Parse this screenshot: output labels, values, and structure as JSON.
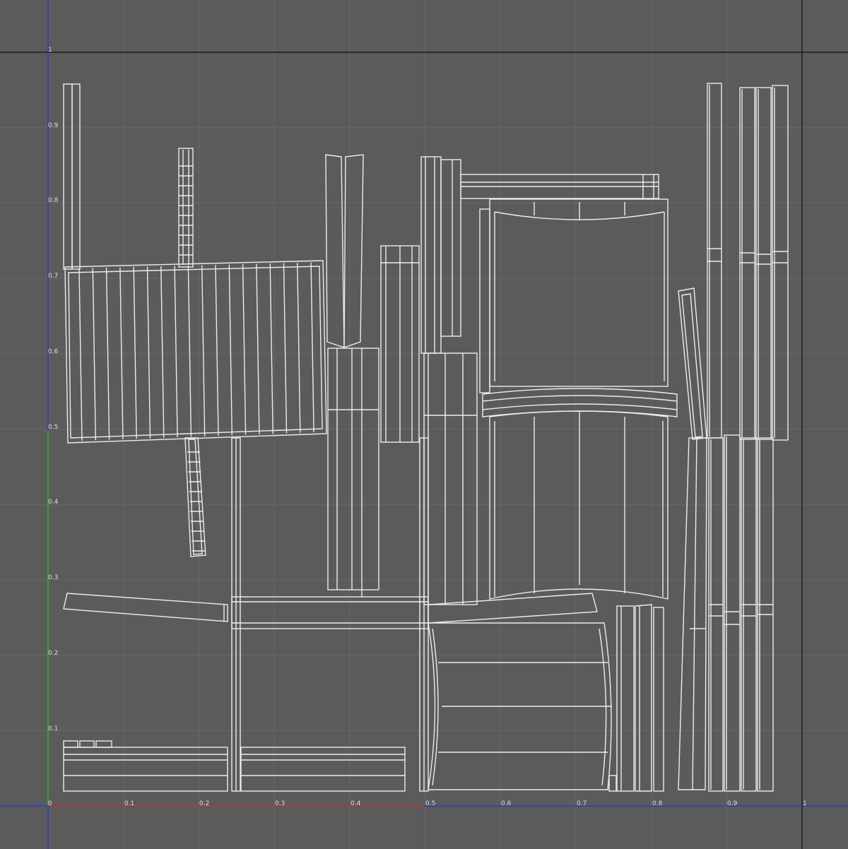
{
  "uv_editor": {
    "colors": {
      "background": "#5b5b5b",
      "grid": "#686868",
      "frame": "#111111",
      "u_axis_positive": "#d22d2d",
      "u_axis_negative": "#2a3ad0",
      "v_axis_positive": "#24b52e",
      "v_axis_negative": "#2a3ad0",
      "wireframe": "#ececec"
    },
    "u_range": [
      0,
      1
    ],
    "v_range": [
      0,
      1
    ],
    "grid_step": 0.1,
    "labels": {
      "origin": "0",
      "u_ticks": [
        "0.1",
        "0.2",
        "0.3",
        "0.4",
        "0.5",
        "0.6",
        "0.7",
        "0.8",
        "0.9",
        "1"
      ],
      "v_ticks": [
        "0.1",
        "0.2",
        "0.3",
        "0.4",
        "0.5",
        "0.6",
        "0.7",
        "0.8",
        "0.9",
        "1"
      ]
    }
  }
}
